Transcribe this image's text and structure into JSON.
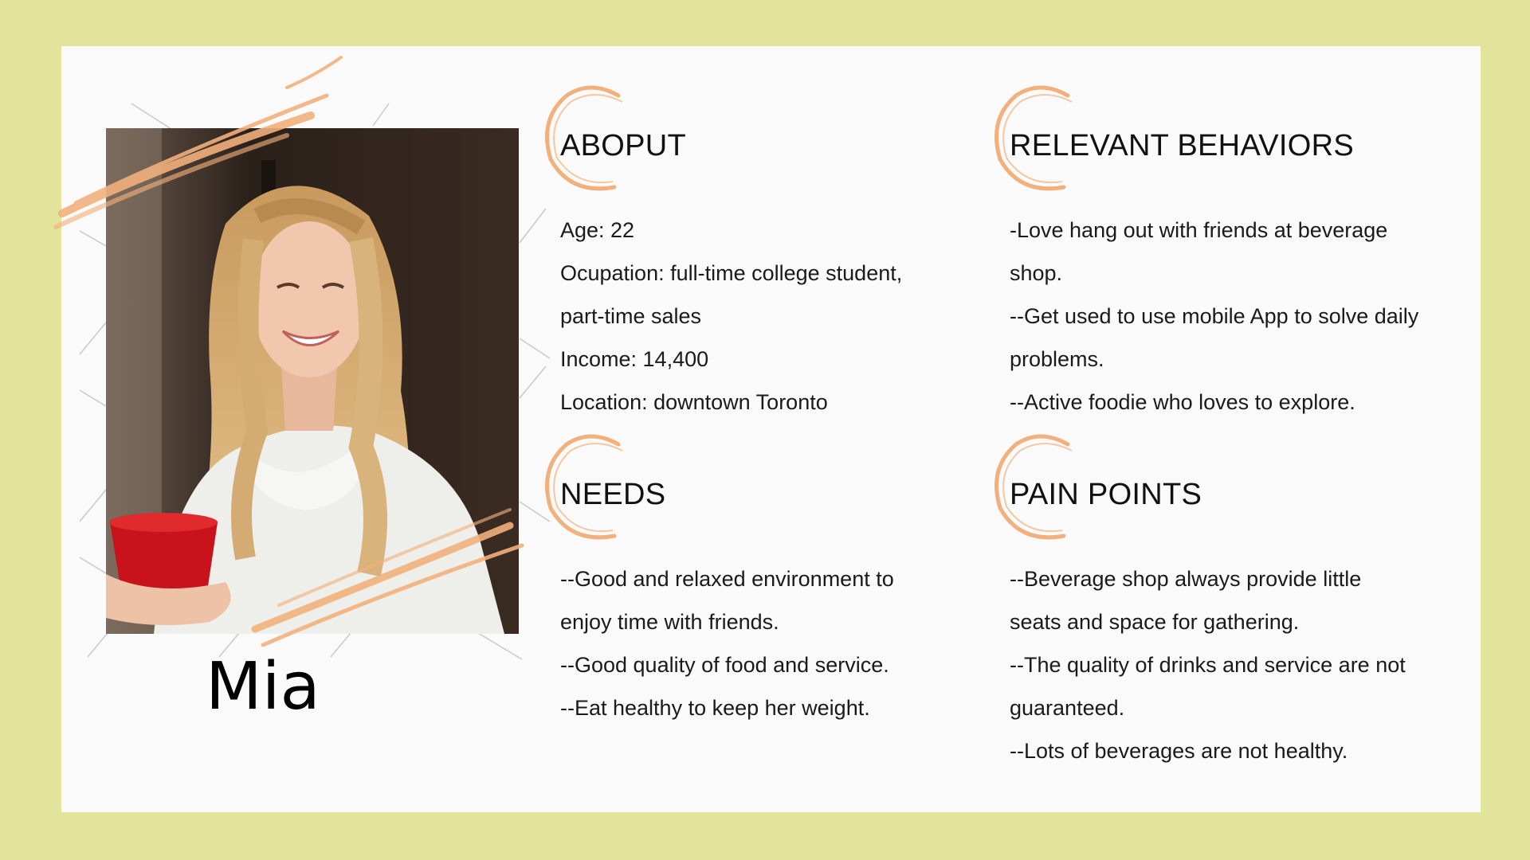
{
  "persona": {
    "name": "Mia",
    "photo_icon": "portrait-photo-icon"
  },
  "colors": {
    "outer_background": "#e2e49c",
    "card_background": "#fafafa",
    "accent_brush": "#f2b07c"
  },
  "sections": {
    "about": {
      "title": "ABOPUT",
      "lines": [
        "Age: 22",
        "Ocupation: full-time college student,",
        "part-time sales",
        "Income: 14,400",
        "Location: downtown Toronto"
      ]
    },
    "behaviors": {
      "title": "RELEVANT BEHAVIORS",
      "lines": [
        "-Love hang out with friends at beverage",
        "shop.",
        "--Get used to use mobile App to solve daily",
        "problems.",
        "--Active foodie who loves to explore."
      ]
    },
    "needs": {
      "title": "NEEDS",
      "lines": [
        "--Good and relaxed environment to",
        "enjoy time with friends.",
        "--Good quality of food and service.",
        "--Eat healthy to keep her weight."
      ]
    },
    "pain_points": {
      "title": "PAIN POINTS",
      "lines": [
        "--Beverage shop always provide little",
        "seats and space for gathering.",
        "--The quality of drinks and service are not",
        "guaranteed.",
        "--Lots of beverages are not healthy."
      ]
    }
  }
}
